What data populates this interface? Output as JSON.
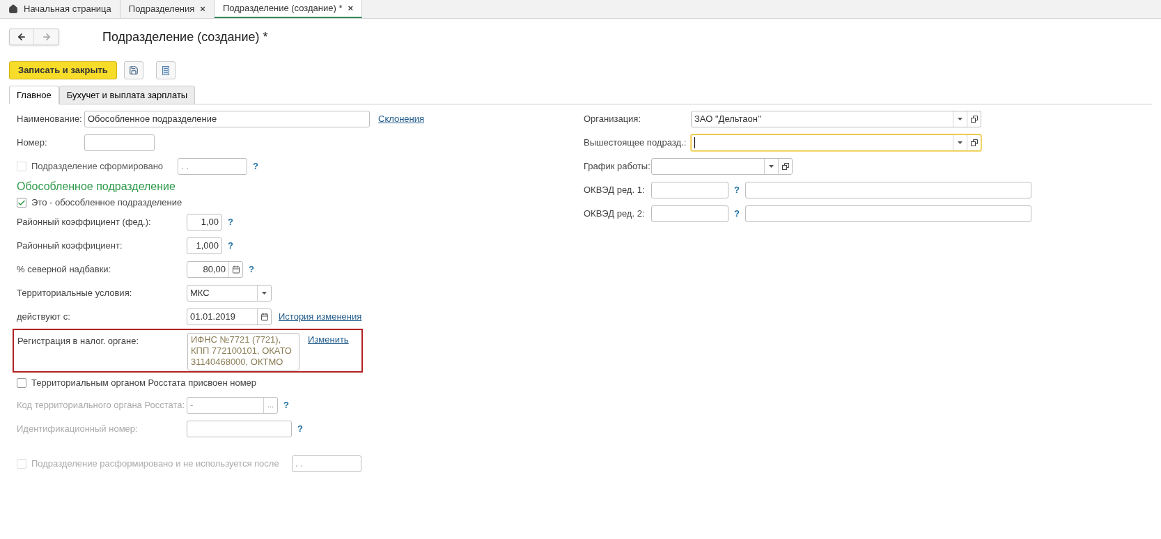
{
  "app_tabs": [
    {
      "label": "Начальная страница",
      "selected": false,
      "kind": "home"
    },
    {
      "label": "Подразделения",
      "selected": false,
      "kind": "closable",
      "close": "×"
    },
    {
      "label": "Подразделение (создание) *",
      "selected": true,
      "kind": "closable",
      "close": "×"
    }
  ],
  "form_title": "Подразделение (создание) *",
  "toolbar": {
    "primary_button": "Записать и закрыть"
  },
  "form_tabs": [
    {
      "label": "Главное",
      "selected": true
    },
    {
      "label": "Бухучет и выплата зарплаты",
      "selected": false
    }
  ],
  "left": {
    "name": {
      "label": "Наименование:",
      "value": "Обособленное подразделение",
      "link": "Склонения"
    },
    "number": {
      "label": "Номер:"
    },
    "formed": {
      "label": "Подразделение сформировано",
      "checked": false,
      "disabled": true,
      "date": ". .",
      "help": "?"
    },
    "section_title": "Обособленное подразделение",
    "separate": {
      "label": "Это - обособленное подразделение",
      "checked": true
    },
    "coef_fed": {
      "label": "Районный коэффициент (фед.):",
      "value": "1,00",
      "help": "?"
    },
    "coef": {
      "label": "Районный коэффициент:",
      "value": "1,000",
      "help": "?"
    },
    "north": {
      "label": "% северной надбавки:",
      "value": "80,00",
      "help": "?"
    },
    "territorial": {
      "label": "Территориальные условия:",
      "value": "МКС"
    },
    "effective": {
      "label": "действуют с:",
      "value": "01.01.2019",
      "link": "История изменения"
    },
    "tax_registration": {
      "label": "Регистрация в налог. органе:",
      "value": "ИФНС №7721 (7721), КПП 772100101, ОКАТО 31140468000, ОКТМО",
      "link": "Изменить",
      "highlighted": true
    },
    "rosstat_assigned": {
      "label": "Территориальным органом Росстата присвоен номер",
      "checked": false
    },
    "rosstat_code": {
      "label": "Код территориального органа Росстата:",
      "placeholder": "-",
      "button": "...",
      "help": "?",
      "disabled": true
    },
    "ident_number": {
      "label": "Идентификационный номер:",
      "help": "?",
      "disabled": true
    },
    "disbanded": {
      "label": "Подразделение расформировано и не используется после",
      "checked": false,
      "disabled": true,
      "date": ". ."
    }
  },
  "right": {
    "organization": {
      "label": "Организация:",
      "value": "ЗАО \"Дельтаон\""
    },
    "parent": {
      "label": "Вышестоящее подразд.:",
      "focused": true
    },
    "schedule": {
      "label": "График работы:"
    },
    "okved1": {
      "label": "ОКВЭД ред. 1:",
      "help": "?"
    },
    "okved2": {
      "label": "ОКВЭД ред. 2:",
      "help": "?"
    }
  }
}
